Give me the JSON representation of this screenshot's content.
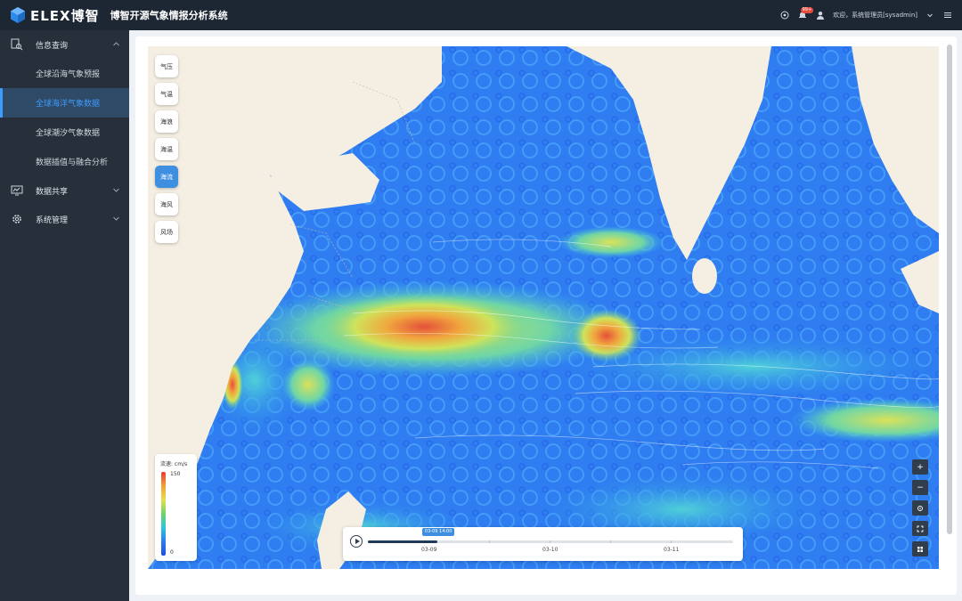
{
  "header": {
    "logo_text": "ELEX博智",
    "app_title": "博智开源气象情报分析系统",
    "notification_count": "99+",
    "welcome_text": "欢迎，系统管理员[sysadmin]"
  },
  "sidebar": {
    "groups": [
      {
        "label": "信息查询",
        "expanded": true,
        "items": [
          {
            "label": "全球沿海气象预报"
          },
          {
            "label": "全球海洋气象数据",
            "active": true
          },
          {
            "label": "全球潮汐气象数据"
          },
          {
            "label": "数据插值与融合分析"
          }
        ]
      },
      {
        "label": "数据共享",
        "expanded": false
      },
      {
        "label": "系统管理",
        "expanded": false
      }
    ]
  },
  "layers": [
    {
      "label": "气压"
    },
    {
      "label": "气温"
    },
    {
      "label": "海浪"
    },
    {
      "label": "海温"
    },
    {
      "label": "海流",
      "active": true
    },
    {
      "label": "海风"
    },
    {
      "label": "风场"
    }
  ],
  "legend": {
    "title": "流速: cm/s",
    "max": "150",
    "min": "0"
  },
  "timeline": {
    "current_tip": "03-09 14:00",
    "progress": 0.19,
    "labels": [
      "03-09",
      "03-10",
      "03-11"
    ]
  },
  "controls": [
    "zoom-in",
    "zoom-out",
    "locate",
    "fullscreen",
    "layers-grid"
  ],
  "colors": {
    "header_bg": "#1d2733",
    "sidebar_bg": "#262f3a",
    "accent": "#3f8fe0",
    "map_land": "#f5efe3"
  }
}
